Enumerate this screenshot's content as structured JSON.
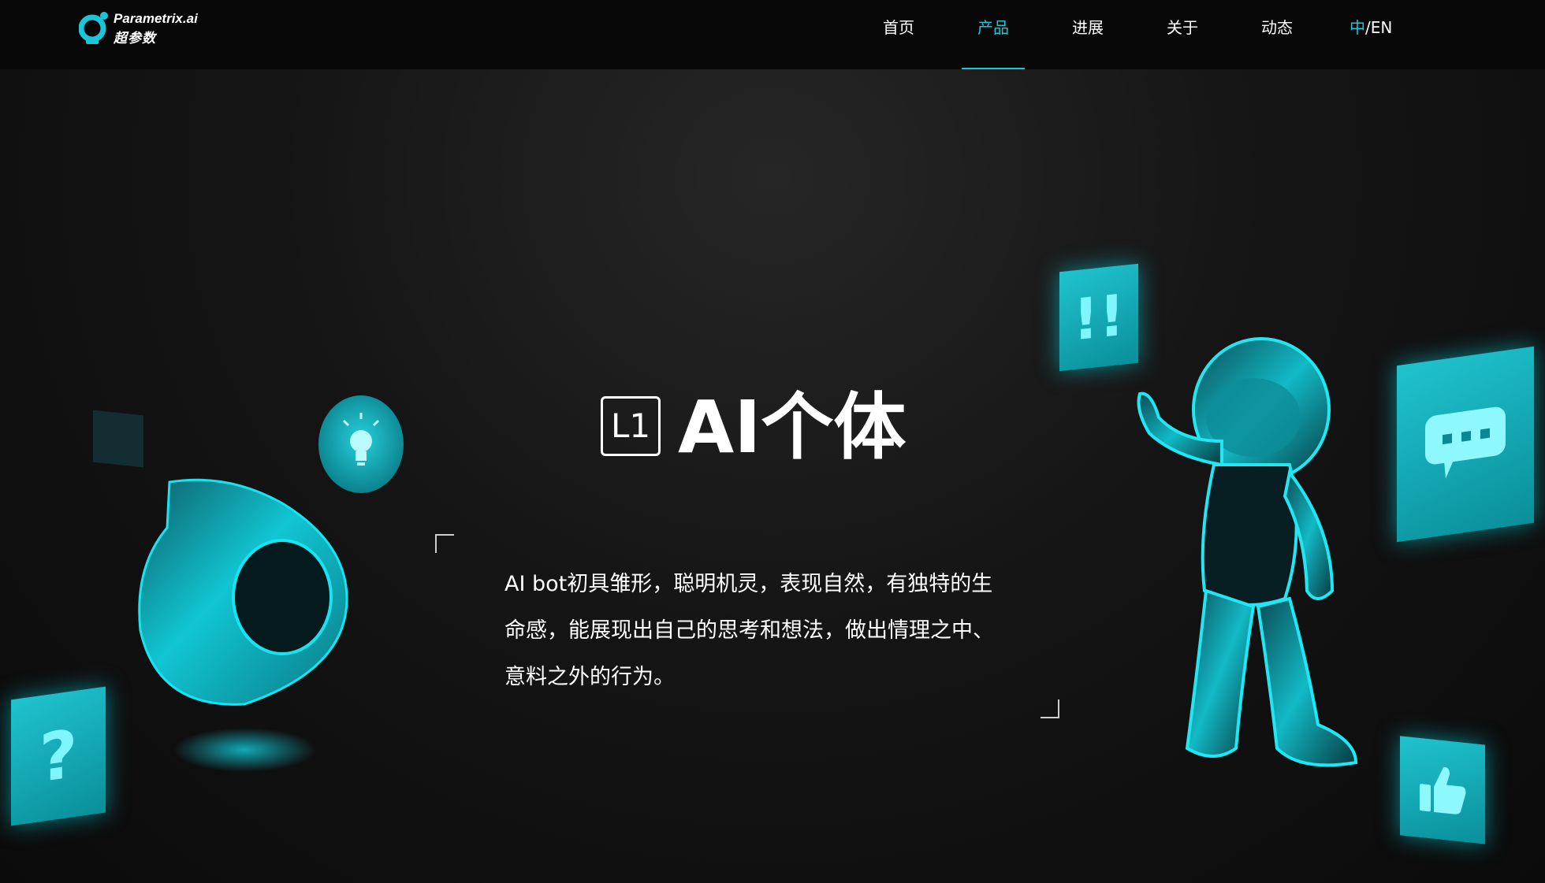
{
  "brand": {
    "name_en": "Parametrix.ai",
    "name_cn": "超参数"
  },
  "nav": {
    "items": [
      {
        "label": "首页",
        "active": false
      },
      {
        "label": "产品",
        "active": true
      },
      {
        "label": "进展",
        "active": false
      },
      {
        "label": "关于",
        "active": false
      },
      {
        "label": "动态",
        "active": false
      }
    ],
    "lang_cn": "中",
    "lang_sep_en": "/EN"
  },
  "hero": {
    "level": "L1",
    "title": "AI个体",
    "description": "AI bot初具雏形，聪明机灵，表现自然，有独特的生命感，能展现出自己的思考和想法，做出情理之中、意料之外的行为。"
  },
  "colors": {
    "accent": "#19c6d8",
    "background": "#111111",
    "header": "#080808"
  },
  "icons": [
    "lightbulb-icon",
    "question-icon",
    "exclamation-icon",
    "chat-bubble-icon",
    "thumbs-up-icon"
  ]
}
